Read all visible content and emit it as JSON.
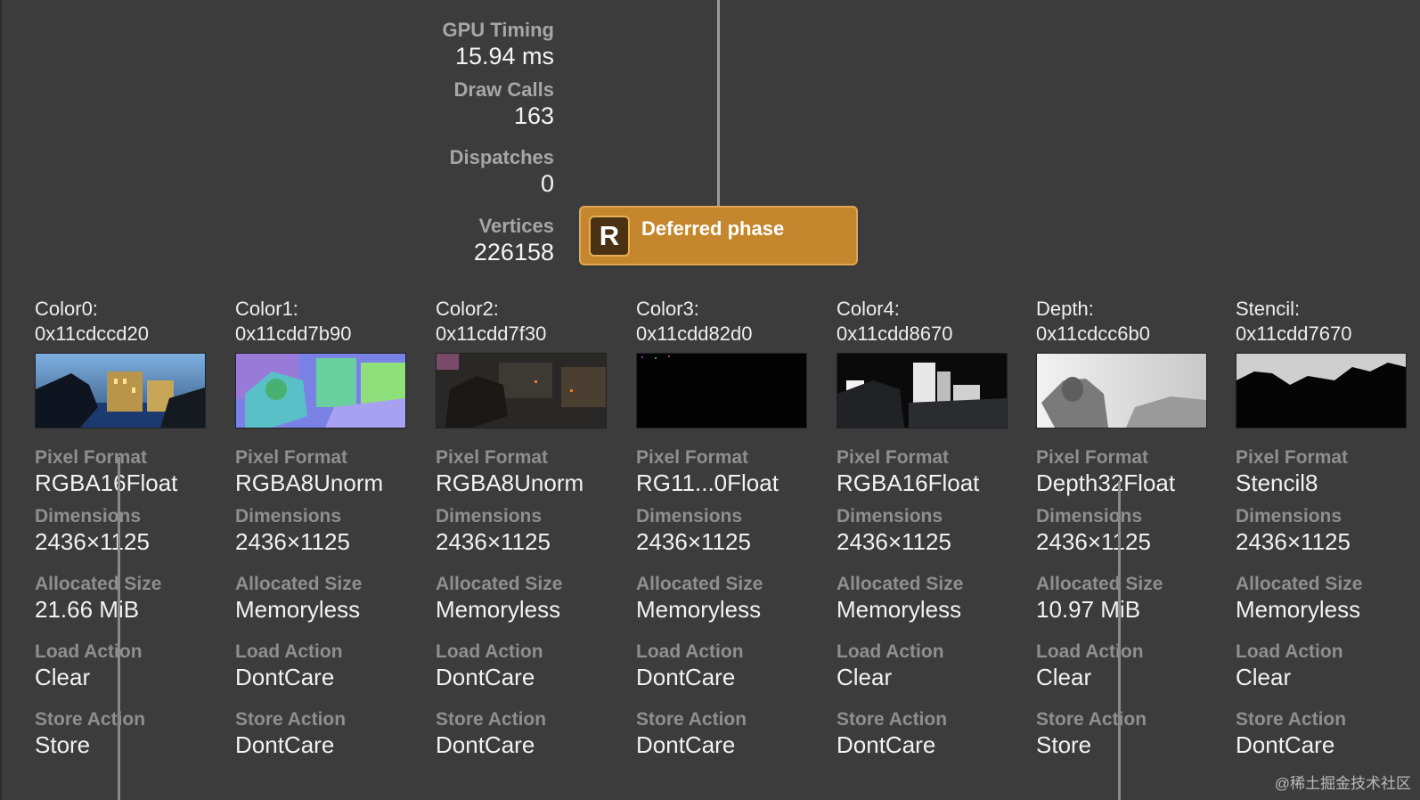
{
  "stats": [
    {
      "label": "GPU Timing",
      "value": "15.94 ms"
    },
    {
      "label": "Draw Calls",
      "value": "163"
    },
    {
      "label": "Dispatches",
      "value": "0"
    },
    {
      "label": "Vertices",
      "value": "226158"
    }
  ],
  "phase": {
    "badge": "R",
    "title": "Deferred phase",
    "color": "#c4872d"
  },
  "attachments": [
    {
      "name": "Color0:",
      "address": "0x11cdccd20",
      "pixel_format": "RGBA16Float",
      "dimensions": "2436×1125",
      "allocated_size": "21.66 MiB",
      "load_action": "Clear",
      "store_action": "Store",
      "thumb_icon": "scene-color-thumbnail"
    },
    {
      "name": "Color1:",
      "address": "0x11cdd7b90",
      "pixel_format": "RGBA8Unorm",
      "dimensions": "2436×1125",
      "allocated_size": "Memoryless",
      "load_action": "DontCare",
      "store_action": "DontCare",
      "thumb_icon": "normals-thumbnail"
    },
    {
      "name": "Color2:",
      "address": "0x11cdd7f30",
      "pixel_format": "RGBA8Unorm",
      "dimensions": "2436×1125",
      "allocated_size": "Memoryless",
      "load_action": "DontCare",
      "store_action": "DontCare",
      "thumb_icon": "albedo-thumbnail"
    },
    {
      "name": "Color3:",
      "address": "0x11cdd82d0",
      "pixel_format": "RG11...0Float",
      "dimensions": "2436×1125",
      "allocated_size": "Memoryless",
      "load_action": "DontCare",
      "store_action": "DontCare",
      "thumb_icon": "black-thumbnail"
    },
    {
      "name": "Color4:",
      "address": "0x11cdd8670",
      "pixel_format": "RGBA16Float",
      "dimensions": "2436×1125",
      "allocated_size": "Memoryless",
      "load_action": "Clear",
      "store_action": "DontCare",
      "thumb_icon": "lighting-thumbnail"
    },
    {
      "name": "Depth:",
      "address": "0x11cdcc6b0",
      "pixel_format": "Depth32Float",
      "dimensions": "2436×1125",
      "allocated_size": "10.97 MiB",
      "load_action": "Clear",
      "store_action": "Store",
      "thumb_icon": "depth-thumbnail"
    },
    {
      "name": "Stencil:",
      "address": "0x11cdd7670",
      "pixel_format": "Stencil8",
      "dimensions": "2436×1125",
      "allocated_size": "Memoryless",
      "load_action": "Clear",
      "store_action": "DontCare",
      "thumb_icon": "stencil-thumbnail"
    }
  ],
  "field_labels": {
    "pixel_format": "Pixel Format",
    "dimensions": "Dimensions",
    "allocated_size": "Allocated Size",
    "load_action": "Load Action",
    "store_action": "Store Action"
  },
  "watermark": "@稀土掘金技术社区"
}
